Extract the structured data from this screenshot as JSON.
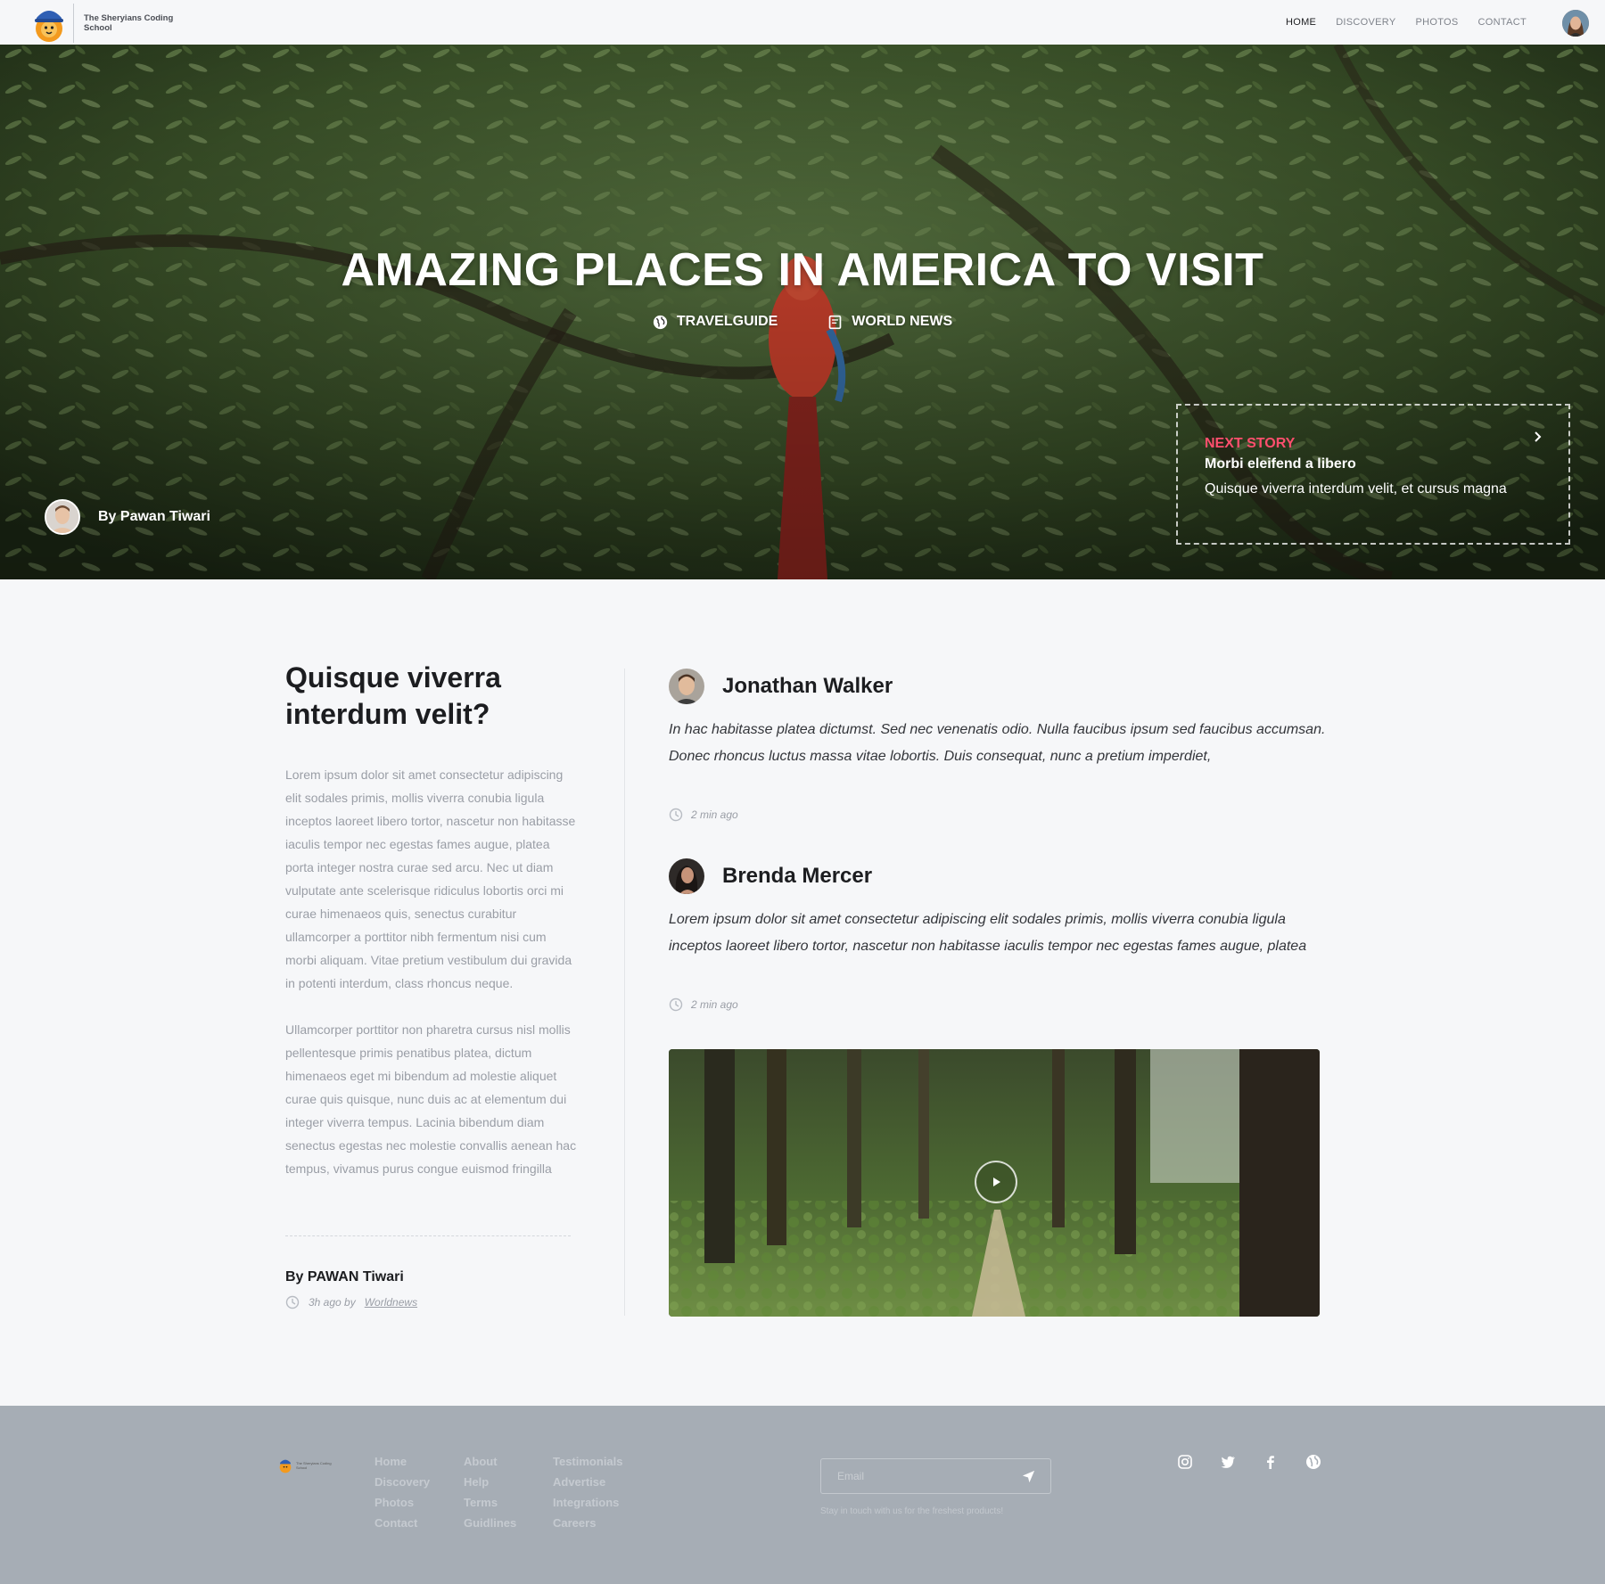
{
  "brand": {
    "name": "The Sheryians Coding School"
  },
  "nav": {
    "links": [
      "HOME",
      "DISCOVERY",
      "PHOTOS",
      "CONTACT"
    ],
    "active": "HOME"
  },
  "hero": {
    "title": "AMAZING PLACES IN AMERICA TO VISIT",
    "tags": [
      {
        "label": "TRAVELGUIDE",
        "icon": "globe-icon"
      },
      {
        "label": "WORLD NEWS",
        "icon": "document-icon"
      }
    ],
    "author": "By Pawan Tiwari",
    "next_story": {
      "label": "NEXT STORY",
      "title": "Morbi eleifend a libero",
      "subtitle": "Quisque viverra interdum velit, et cursus magna"
    }
  },
  "article": {
    "title": "Quisque viverra interdum velit?",
    "paragraphs": [
      "Lorem ipsum dolor sit amet consectetur adipiscing elit sodales primis, mollis viverra conubia ligula inceptos laoreet libero tortor, nascetur non habitasse iaculis tempor nec egestas fames augue, platea porta integer nostra curae sed arcu. Nec ut diam vulputate ante scelerisque ridiculus lobortis orci mi curae himenaeos quis, senectus curabitur ullamcorper a porttitor nibh fermentum nisi cum morbi aliquam. Vitae pretium vestibulum dui gravida in potenti interdum, class rhoncus neque.",
      "Ullamcorper porttitor non pharetra cursus nisl mollis pellentesque primis penatibus platea, dictum himenaeos eget mi bibendum ad molestie aliquet curae quis quisque, nunc duis ac at elementum dui integer viverra tempus. Lacinia bibendum diam senectus egestas nec molestie convallis aenean hac tempus, vivamus purus congue euismod fringilla"
    ],
    "byline": "By PAWAN Tiwari",
    "meta_time": "3h ago by",
    "meta_source": "Worldnews"
  },
  "comments": [
    {
      "name": "Jonathan Walker",
      "body": "In hac habitasse platea dictumst. Sed nec venenatis odio. Nulla faucibus ipsum sed faucibus accumsan. Donec rhoncus luctus massa vitae lobortis. Duis consequat, nunc a pretium imperdiet,",
      "time": "2 min ago"
    },
    {
      "name": "Brenda Mercer",
      "body": "Lorem ipsum dolor sit amet consectetur adipiscing elit sodales primis, mollis viverra conubia ligula inceptos laoreet libero tortor, nascetur non habitasse iaculis tempor nec egestas fames augue, platea",
      "time": "2 min ago"
    }
  ],
  "footer": {
    "col1": [
      "Home",
      "Discovery",
      "Photos",
      "Contact"
    ],
    "col2": [
      "About",
      "Help",
      "Terms",
      "Guidlines"
    ],
    "col3": [
      "Testimonials",
      "Advertise",
      "Integrations",
      "Careers"
    ],
    "email_placeholder": "Email",
    "note": "Stay in touch with us for the freshest products!",
    "social": [
      "instagram-icon",
      "twitter-icon",
      "facebook-icon",
      "globe-icon"
    ]
  },
  "colors": {
    "accent": "#ff4f6e",
    "footer_bg": "#a6adb5",
    "page_bg": "#f6f7f9"
  }
}
